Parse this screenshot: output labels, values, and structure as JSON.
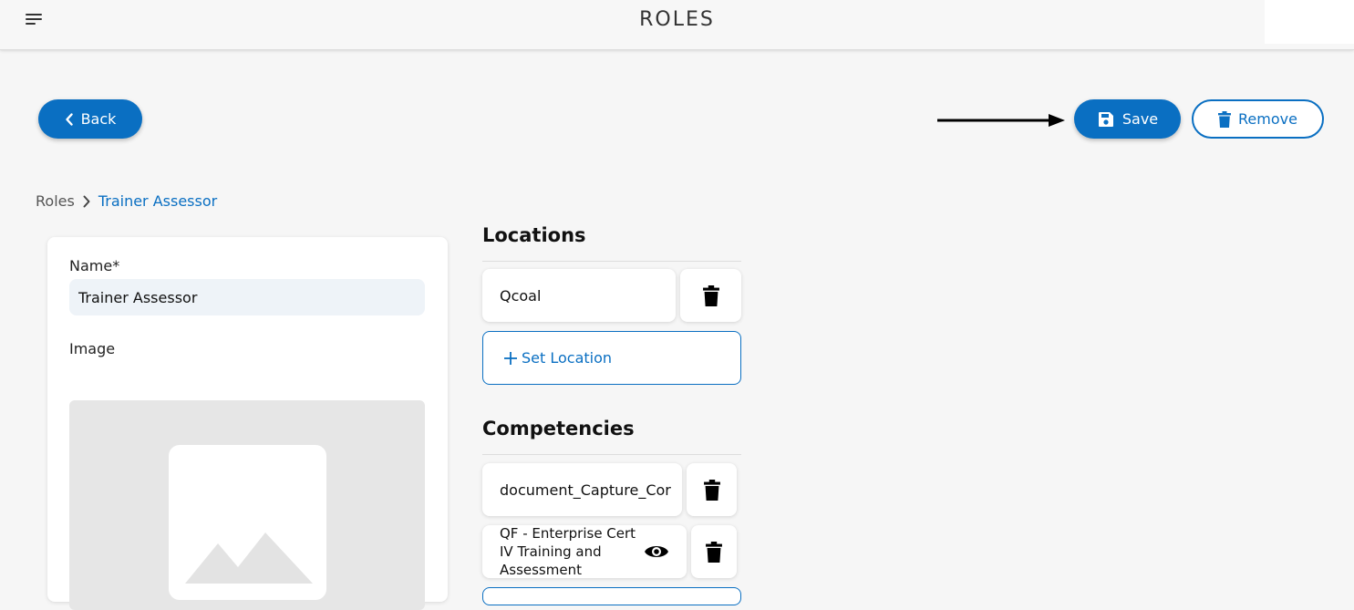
{
  "header": {
    "title": "ROLES"
  },
  "toolbar": {
    "back_label": "Back",
    "save_label": "Save",
    "remove_label": "Remove"
  },
  "breadcrumb": {
    "root": "Roles",
    "current": "Trainer Assessor"
  },
  "form": {
    "name_label": "Name*",
    "name_value": "Trainer Assessor",
    "image_label": "Image"
  },
  "locations": {
    "title": "Locations",
    "items": [
      {
        "label": "Qcoal"
      }
    ],
    "add_label": "Set Location"
  },
  "competencies": {
    "title": "Competencies",
    "items": [
      {
        "label": "document_Capture_Cor"
      },
      {
        "label": "QF - Enterprise Cert IV Training and Assessment"
      }
    ]
  },
  "colors": {
    "accent": "#0a6fc2",
    "input_bg": "#eef3f8",
    "placeholder_bg": "#e6e6e6"
  },
  "icons": [
    "menu-icon",
    "chevron-left-icon",
    "save-icon",
    "trash-icon",
    "chevron-right-icon",
    "plus-icon",
    "eye-icon",
    "image-placeholder-icon",
    "arrow-right-icon"
  ]
}
